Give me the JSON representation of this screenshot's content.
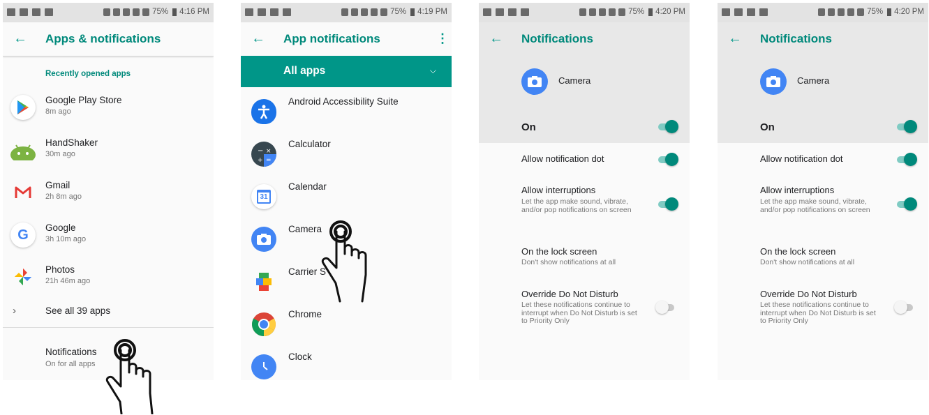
{
  "status_bar": {
    "battery": "75%"
  },
  "screen1": {
    "time": "4:16 PM",
    "title": "Apps & notifications",
    "section_header": "Recently opened apps",
    "recent_apps": [
      {
        "name": "Google Play Store",
        "time": "8m ago",
        "icon": "play-store-icon"
      },
      {
        "name": "HandShaker",
        "time": "30m ago",
        "icon": "handshaker-icon"
      },
      {
        "name": "Gmail",
        "time": "2h 8m ago",
        "icon": "gmail-icon"
      },
      {
        "name": "Google",
        "time": "3h 10m ago",
        "icon": "google-icon"
      },
      {
        "name": "Photos",
        "time": "21h 46m ago",
        "icon": "photos-icon"
      }
    ],
    "see_all": "See all 39 apps",
    "notifications_title": "Notifications",
    "notifications_sub": "On for all apps"
  },
  "screen2": {
    "time": "4:19 PM",
    "title": "App notifications",
    "filter": "All apps",
    "apps": [
      {
        "name": "Android Accessibility Suite",
        "icon": "accessibility-icon"
      },
      {
        "name": "Calculator",
        "icon": "calculator-icon"
      },
      {
        "name": "Calendar",
        "icon": "calendar-icon",
        "icon_text": "31"
      },
      {
        "name": "Camera",
        "icon": "camera-icon"
      },
      {
        "name": "Carrier S",
        "icon": "carrier-services-icon"
      },
      {
        "name": "Chrome",
        "icon": "chrome-icon"
      },
      {
        "name": "Clock",
        "icon": "clock-icon"
      }
    ]
  },
  "notification_screen": {
    "title": "Notifications",
    "app_name": "Camera",
    "on_label": "On",
    "settings": [
      {
        "title": "Allow notification dot",
        "sub": "",
        "enabled": true
      },
      {
        "title": "Allow interruptions",
        "sub": "Let the app make sound, vibrate, and/or pop notifications on screen",
        "enabled": true
      },
      {
        "title": "On the lock screen",
        "sub": "Don't show notifications at all"
      },
      {
        "title": "Override Do Not Disturb",
        "sub": "Let these notifications continue to interrupt when Do Not Disturb is set to Priority Only",
        "enabled": false
      }
    ]
  },
  "screen3": {
    "time": "4:20 PM"
  },
  "screen4": {
    "time": "4:20 PM"
  },
  "colors": {
    "accent": "#009688",
    "accent_dark": "#00897b"
  }
}
